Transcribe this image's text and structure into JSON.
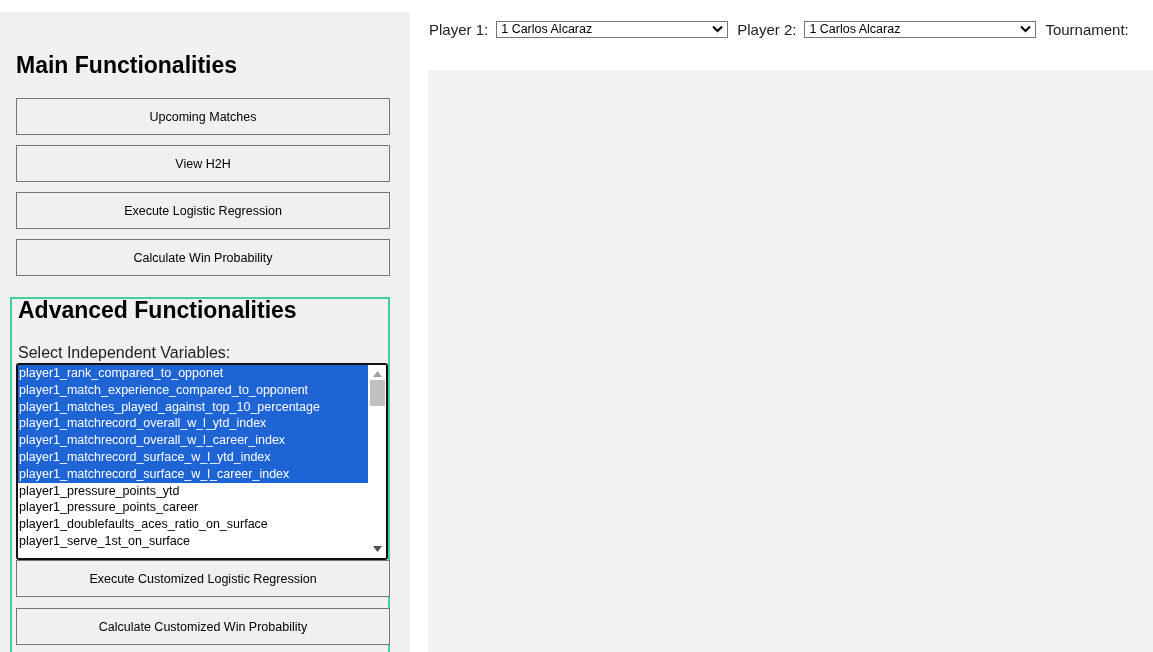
{
  "sidebar": {
    "main_title": "Main Functionalities",
    "main_buttons": [
      "Upcoming Matches",
      "View H2H",
      "Execute Logistic Regression",
      "Calculate Win Probability"
    ],
    "advanced_title": "Advanced Functionalities",
    "variables_label": "Select Independent Variables:",
    "variables": [
      {
        "label": "player1_rank_compared_to_opponet",
        "selected": true
      },
      {
        "label": "player1_match_experience_compared_to_opponent",
        "selected": true
      },
      {
        "label": "player1_matches_played_against_top_10_percentage",
        "selected": true
      },
      {
        "label": "player1_matchrecord_overall_w_l_ytd_index",
        "selected": true
      },
      {
        "label": "player1_matchrecord_overall_w_l_career_index",
        "selected": true
      },
      {
        "label": "player1_matchrecord_surface_w_l_ytd_index",
        "selected": true
      },
      {
        "label": "player1_matchrecord_surface_w_l_career_index",
        "selected": true
      },
      {
        "label": "player1_pressure_points_ytd",
        "selected": false
      },
      {
        "label": "player1_pressure_points_career",
        "selected": false
      },
      {
        "label": "player1_doublefaults_aces_ratio_on_surface",
        "selected": false
      },
      {
        "label": "player1_serve_1st_on_surface",
        "selected": false
      }
    ],
    "advanced_buttons": [
      "Execute Customized Logistic Regression",
      "Calculate Customized Win Probability"
    ]
  },
  "filters": [
    {
      "label": "Player 1:",
      "value": "1 Carlos Alcaraz"
    },
    {
      "label": "Player 2:",
      "value": "1 Carlos Alcaraz"
    }
  ],
  "tournament_label": "Tournament:"
}
